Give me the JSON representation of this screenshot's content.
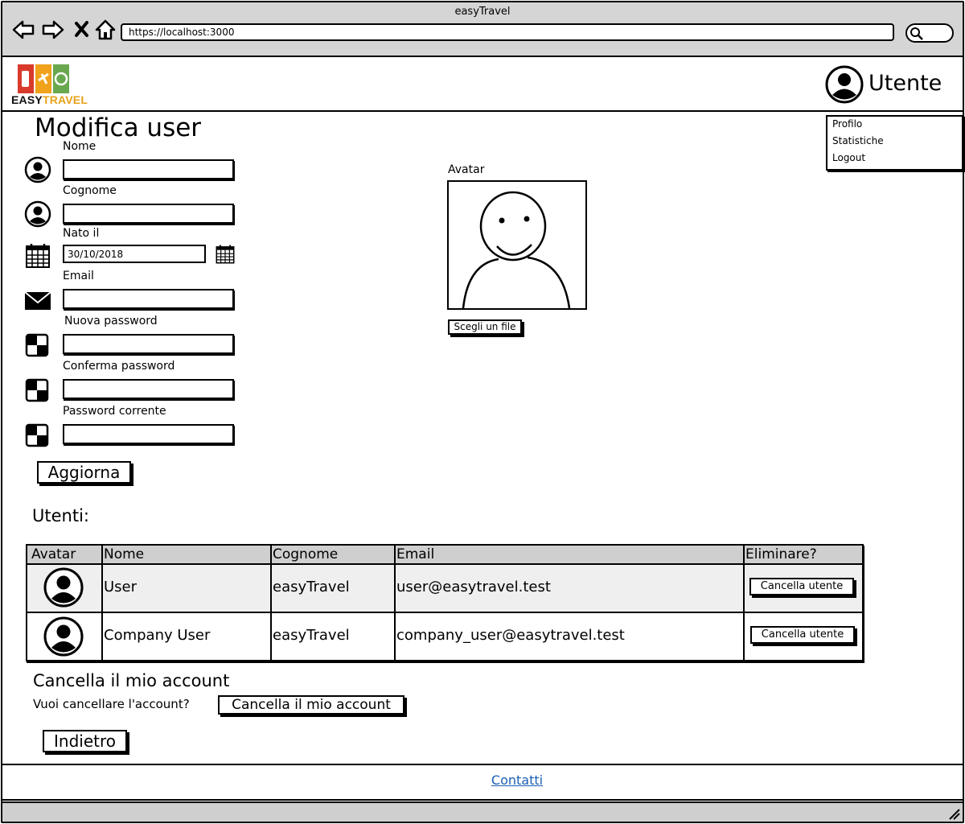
{
  "browser": {
    "window_title": "easyTravel",
    "url": "https://localhost:3000"
  },
  "header": {
    "logo_text_1": "EASY",
    "logo_text_2": "TRAVEL",
    "user_name": "Utente",
    "menu": [
      "Profilo",
      "Statistiche",
      "Logout"
    ]
  },
  "form": {
    "title": "Modifica user",
    "fields": {
      "nome": {
        "label": "Nome",
        "value": ""
      },
      "cognome": {
        "label": "Cognome",
        "value": ""
      },
      "nato_il": {
        "label": "Nato il",
        "value": "30/10/2018"
      },
      "email": {
        "label": "Email",
        "value": ""
      },
      "nuova_password": {
        "label": "Nuova password",
        "value": ""
      },
      "conferma_password": {
        "label": "Conferma password",
        "value": ""
      },
      "password_corrente": {
        "label": "Password corrente",
        "value": ""
      }
    },
    "update_button": "Aggiorna",
    "avatar_label": "Avatar",
    "choose_file_button": "Scegli un file"
  },
  "users": {
    "heading": "Utenti:",
    "columns": [
      "Avatar",
      "Nome",
      "Cognome",
      "Email",
      "Eliminare?"
    ],
    "rows": [
      {
        "nome": "User",
        "cognome": "easyTravel",
        "email": "user@easytravel.test",
        "action": "Cancella utente"
      },
      {
        "nome": "Company User",
        "cognome": "easyTravel",
        "email": "company_user@easytravel.test",
        "action": "Cancella utente"
      }
    ]
  },
  "delete_account": {
    "heading": "Cancella il mio account",
    "question": "Vuoi cancellare l'account?",
    "button": "Cancella il mio account"
  },
  "back_button": "Indietro",
  "footer": {
    "contacts_link": "Contatti"
  },
  "icons": {
    "back": "arrow-left-icon",
    "forward": "arrow-right-icon",
    "stop": "close-icon",
    "home": "home-icon",
    "search": "search-icon",
    "user": "user-avatar-icon",
    "calendar": "calendar-icon",
    "email": "envelope-icon",
    "password": "password-checker-icon",
    "resize": "resize-grip-icon"
  }
}
